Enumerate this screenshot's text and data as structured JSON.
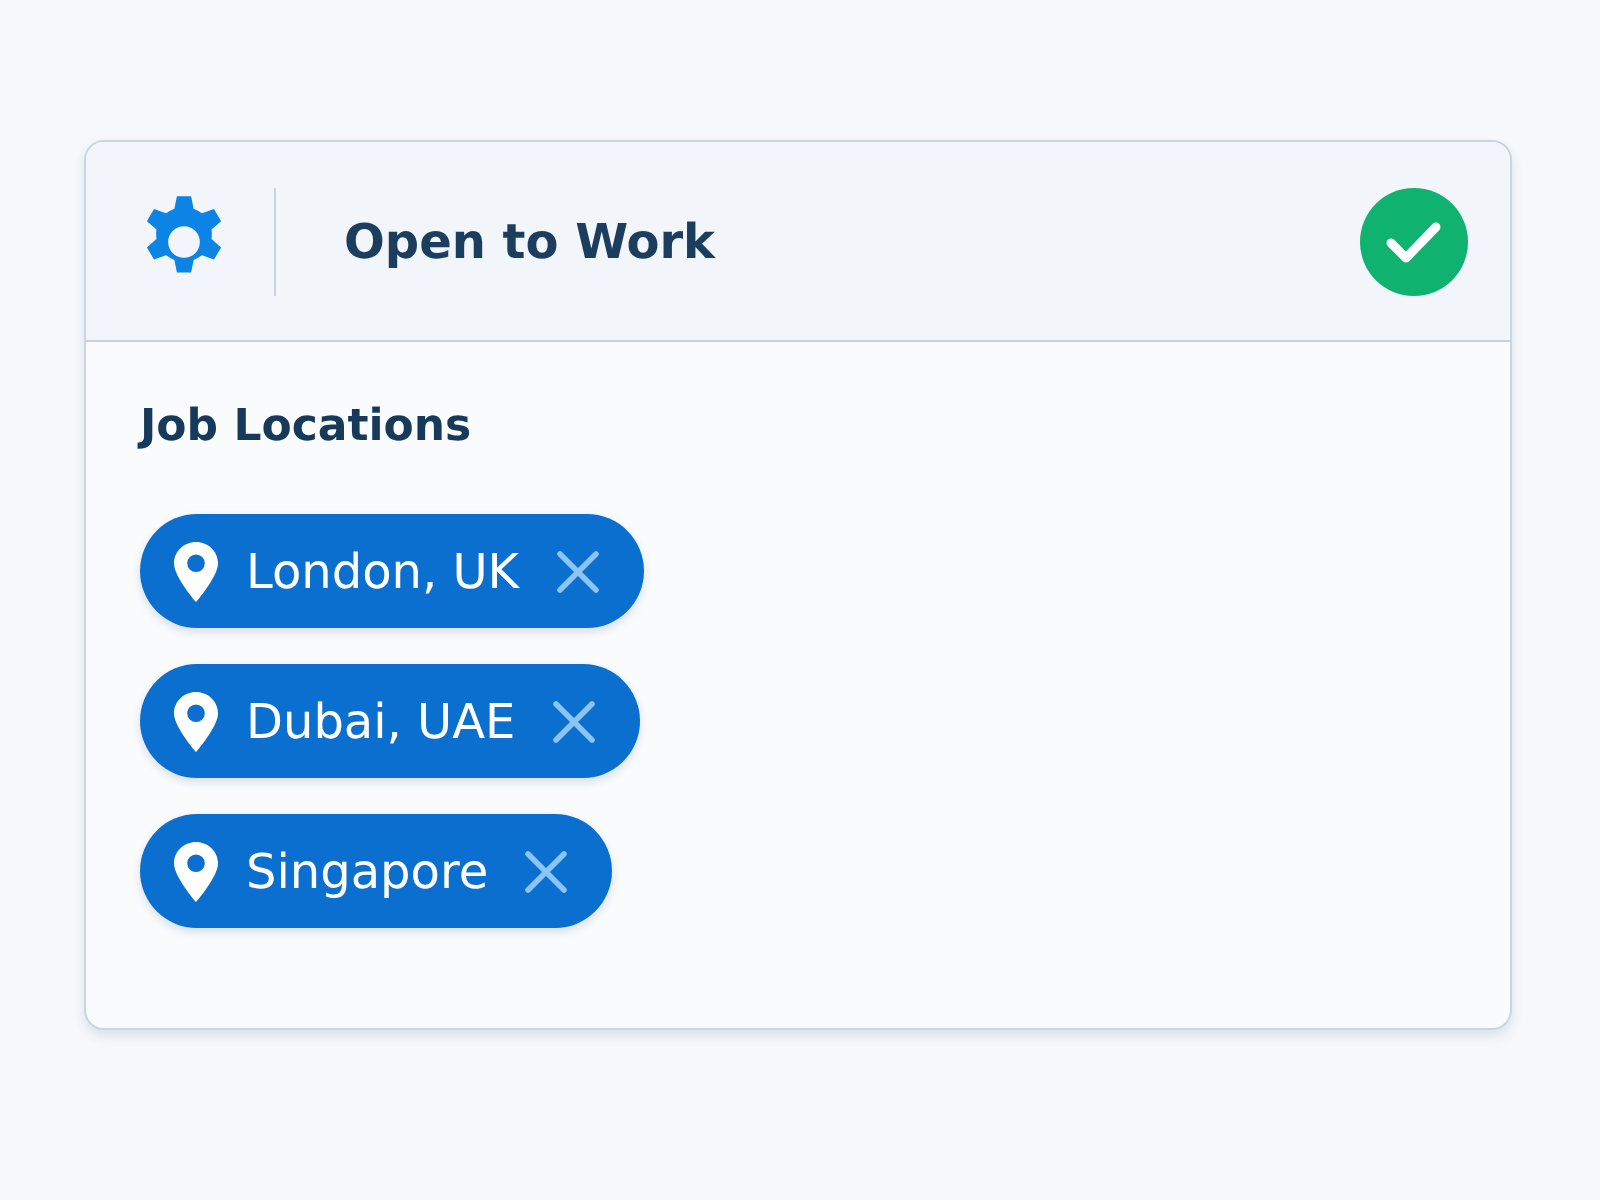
{
  "header": {
    "title": "Open to Work"
  },
  "section": {
    "heading": "Job Locations"
  },
  "locations": [
    {
      "label": "London, UK"
    },
    {
      "label": "Dubai, UAE"
    },
    {
      "label": "Singapore"
    }
  ]
}
